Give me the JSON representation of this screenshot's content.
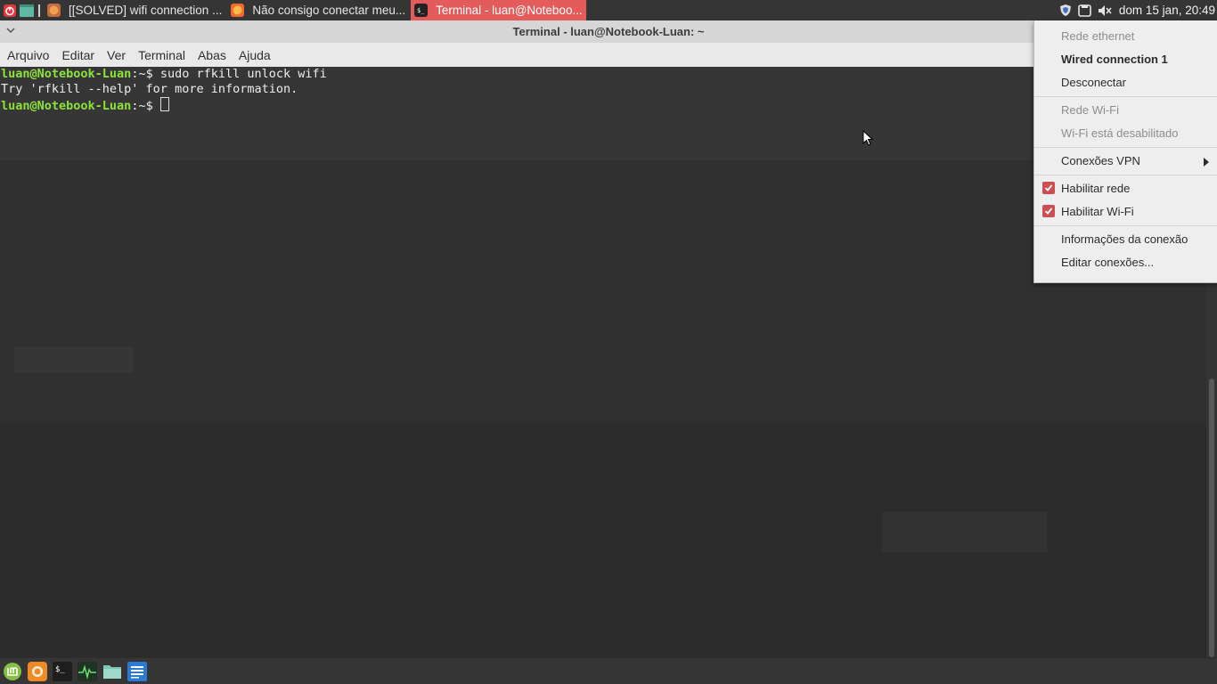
{
  "top_panel": {
    "tasks": [
      {
        "label": "[[SOLVED] wifi connection ...",
        "icon": "firefox-icon"
      },
      {
        "label": "Não consigo conectar meu...",
        "icon": "firefox-icon"
      },
      {
        "label": "Terminal - luan@Noteboo...",
        "icon": "terminal-icon",
        "active": true
      }
    ],
    "clock": "dom 15 jan, 20:49"
  },
  "window": {
    "title": "Terminal - luan@Notebook-Luan: ~",
    "menu": [
      "Arquivo",
      "Editar",
      "Ver",
      "Terminal",
      "Abas",
      "Ajuda"
    ]
  },
  "terminal": {
    "prompt": "luan@Notebook-Luan",
    "path_suffix": ":~$",
    "command1": " sudo rfkill unlock wifi",
    "output1": "Try 'rfkill --help' for more information."
  },
  "network_menu": {
    "ethernet_header": "Rede ethernet",
    "wired_connection": "Wired connection 1",
    "disconnect": "Desconectar",
    "wifi_header": "Rede Wi-Fi",
    "wifi_disabled": "Wi-Fi está desabilitado",
    "vpn": "Conexões VPN",
    "enable_network": "Habilitar rede",
    "enable_wifi": "Habilitar Wi-Fi",
    "connection_info": "Informações da conexão",
    "edit_connections": "Editar conexões..."
  },
  "colors": {
    "accent": "#e35b5b",
    "prompt": "#8ae234",
    "panel": "#353535"
  }
}
